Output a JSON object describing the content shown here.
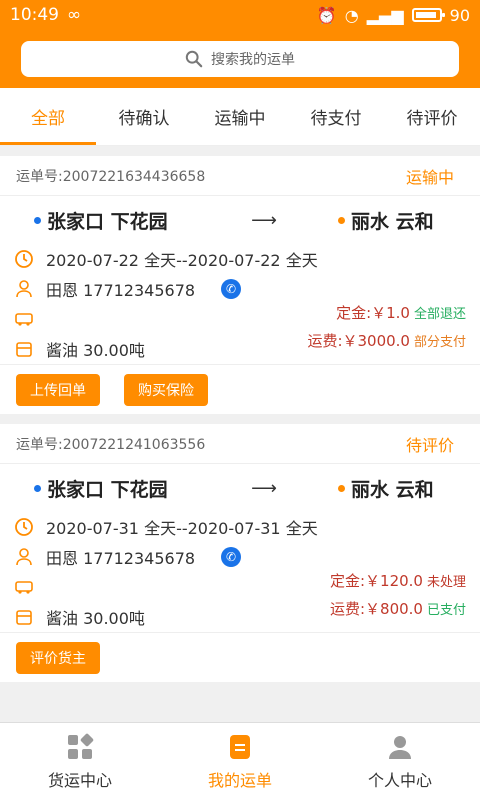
{
  "status_bar": {
    "time": "10:49",
    "battery": "90"
  },
  "search": {
    "placeholder": "搜索我的运单"
  },
  "tabs": [
    "全部",
    "待确认",
    "运输中",
    "待支付",
    "待评价"
  ],
  "orders": [
    {
      "waybill": "运单号:2007221634436658",
      "status": "运输中",
      "from": "张家口 下花园",
      "to": "丽水 云和",
      "date": "2020-07-22  全天--2020-07-22  全天",
      "contact": "田恩 17712345678",
      "deposit_label": "定金:￥1.0",
      "deposit_tag": "全部退还",
      "fee_label": "运费:￥3000.0",
      "fee_tag": "部分支付",
      "cargo": "酱油    30.00吨",
      "buttons": [
        "上传回单",
        "购买保险"
      ]
    },
    {
      "waybill": "运单号:2007221241063556",
      "status": "待评价",
      "from": "张家口 下花园",
      "to": "丽水 云和",
      "date": "2020-07-31  全天--2020-07-31  全天",
      "contact": "田恩 17712345678",
      "deposit_label": "定金:￥120.0",
      "deposit_tag": "未处理",
      "fee_label": "运费:￥800.0",
      "fee_tag": "已支付",
      "cargo": "酱油    30.00吨",
      "buttons": [
        "评价货主"
      ]
    }
  ],
  "bottom_nav": [
    "货运中心",
    "我的运单",
    "个人中心"
  ],
  "colors": {
    "accent": "#ff8c00",
    "blue": "#1a73e8",
    "red": "#c0392b",
    "green": "#27ae60",
    "orange": "#e67e22"
  }
}
